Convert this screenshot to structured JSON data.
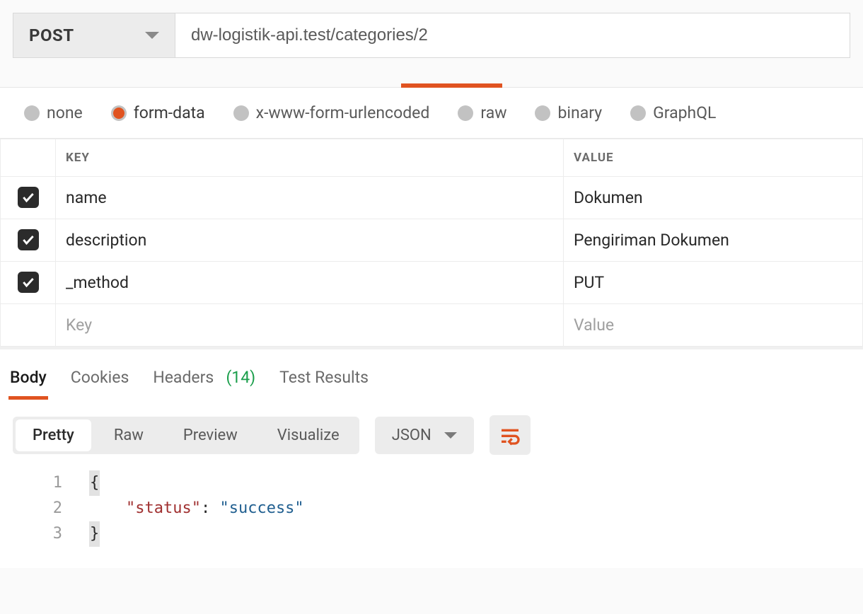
{
  "request": {
    "method": "POST",
    "url": "dw-logistik-api.test/categories/2"
  },
  "body_types": [
    {
      "id": "none",
      "label": "none",
      "selected": false
    },
    {
      "id": "form-data",
      "label": "form-data",
      "selected": true
    },
    {
      "id": "x-www-form-urlencoded",
      "label": "x-www-form-urlencoded",
      "selected": false
    },
    {
      "id": "raw",
      "label": "raw",
      "selected": false
    },
    {
      "id": "binary",
      "label": "binary",
      "selected": false
    },
    {
      "id": "graphql",
      "label": "GraphQL",
      "selected": false
    }
  ],
  "kv_headers": {
    "key": "KEY",
    "value": "VALUE"
  },
  "form_data": [
    {
      "enabled": true,
      "key": "name",
      "value": "Dokumen"
    },
    {
      "enabled": true,
      "key": "description",
      "value": "Pengiriman Dokumen"
    },
    {
      "enabled": true,
      "key": "_method",
      "value": "PUT"
    }
  ],
  "new_row_placeholder": {
    "key": "Key",
    "value": "Value"
  },
  "response_tabs": {
    "body": "Body",
    "cookies": "Cookies",
    "headers": "Headers",
    "headers_count": "(14)",
    "test_results": "Test Results"
  },
  "format_tabs": {
    "pretty": "Pretty",
    "raw": "Raw",
    "preview": "Preview",
    "visualize": "Visualize"
  },
  "language": "JSON",
  "response_body": {
    "line1": "{",
    "line2_key": "\"status\"",
    "line2_colon": ": ",
    "line2_value": "\"success\"",
    "line3": "}"
  },
  "line_numbers": [
    "1",
    "2",
    "3"
  ]
}
